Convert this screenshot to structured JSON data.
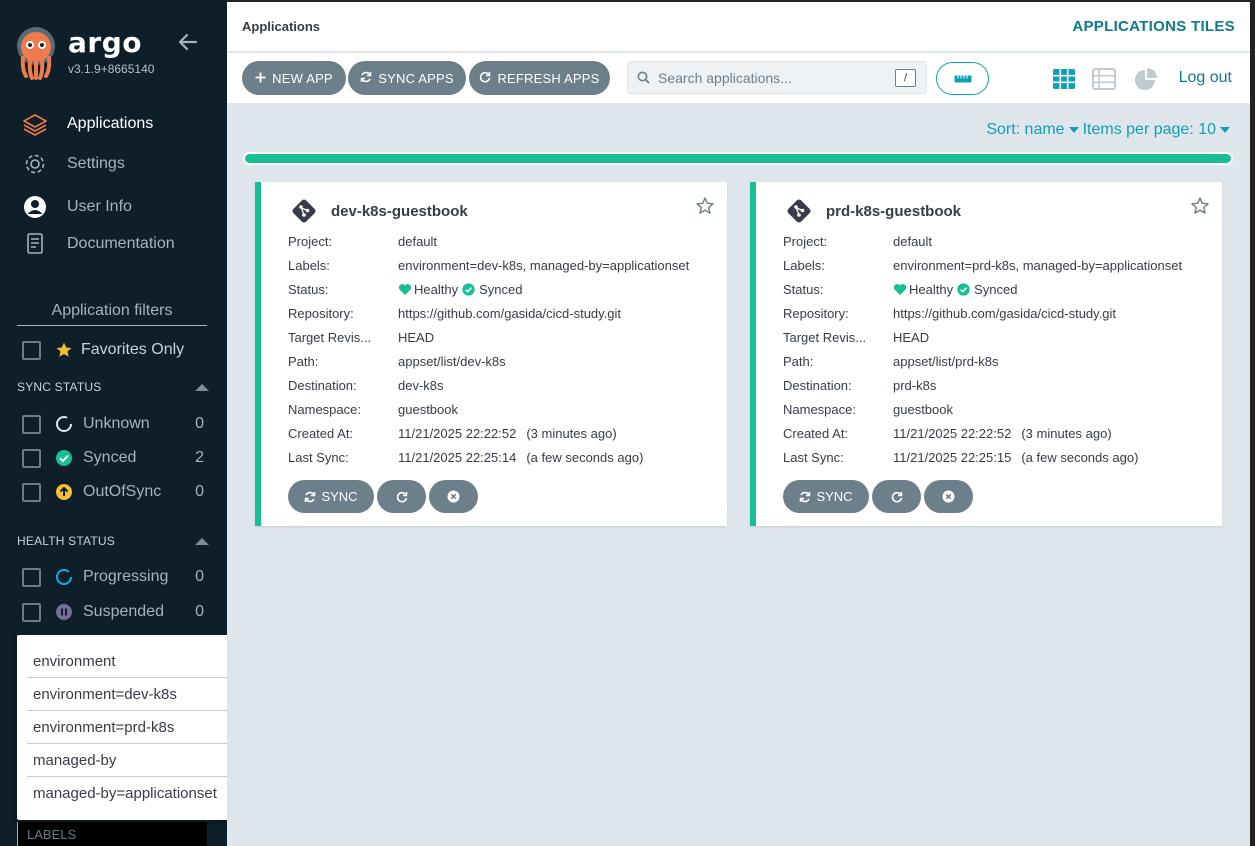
{
  "brand": {
    "title": "argo",
    "version": "v3.1.9+8665140"
  },
  "nav": [
    {
      "label": "Applications",
      "icon": "layers-icon"
    },
    {
      "label": "Settings",
      "icon": "gear-icon"
    },
    {
      "label": "User Info",
      "icon": "user-circle-icon"
    },
    {
      "label": "Documentation",
      "icon": "doc-icon"
    }
  ],
  "filters": {
    "title": "Application filters",
    "favorites_label": "Favorites Only",
    "sync_status": {
      "heading": "SYNC STATUS",
      "items": [
        {
          "label": "Unknown",
          "count": "0"
        },
        {
          "label": "Synced",
          "count": "2"
        },
        {
          "label": "OutOfSync",
          "count": "0"
        }
      ]
    },
    "health_status": {
      "heading": "HEALTH STATUS",
      "items": [
        {
          "label": "Progressing",
          "count": "0"
        },
        {
          "label": "Suspended",
          "count": "0"
        }
      ]
    },
    "label_options": [
      "environment",
      "environment=dev-k8s",
      "environment=prd-k8s",
      "managed-by",
      "managed-by=applicationset"
    ],
    "labels_placeholder": "LABELS"
  },
  "header": {
    "breadcrumb": "Applications",
    "page_tag": "APPLICATIONS TILES"
  },
  "toolbar": {
    "new_app": "NEW APP",
    "sync_apps": "SYNC APPS",
    "refresh_apps": "REFRESH APPS",
    "search_placeholder": "Search applications...",
    "search_shortcut": "/",
    "logout": "Log out"
  },
  "sort": {
    "label": "Sort: name",
    "items_per_page": "Items per page: 10"
  },
  "progress": {
    "percent": 100
  },
  "field_labels": {
    "project": "Project:",
    "labels": "Labels:",
    "status": "Status:",
    "repository": "Repository:",
    "target_revision": "Target Revis...",
    "path": "Path:",
    "destination": "Destination:",
    "namespace": "Namespace:",
    "created_at": "Created At:",
    "last_sync": "Last Sync:"
  },
  "apps": [
    {
      "name": "dev-k8s-guestbook",
      "project": "default",
      "labels": "environment=dev-k8s, managed-by=applicationset",
      "health": "Healthy",
      "sync": "Synced",
      "repository": "https://github.com/gasida/cicd-study.git",
      "target_revision": "HEAD",
      "path": "appset/list/dev-k8s",
      "destination": "dev-k8s",
      "namespace": "guestbook",
      "created_at": "11/21/2025 22:22:52",
      "created_rel": "(3 minutes ago)",
      "last_sync": "11/21/2025 22:25:14",
      "last_sync_rel": "(a few seconds ago)",
      "sync_button": "SYNC"
    },
    {
      "name": "prd-k8s-guestbook",
      "project": "default",
      "labels": "environment=prd-k8s, managed-by=applicationset",
      "health": "Healthy",
      "sync": "Synced",
      "repository": "https://github.com/gasida/cicd-study.git",
      "target_revision": "HEAD",
      "path": "appset/list/prd-k8s",
      "destination": "prd-k8s",
      "namespace": "guestbook",
      "created_at": "11/21/2025 22:22:52",
      "created_rel": "(3 minutes ago)",
      "last_sync": "11/21/2025 22:25:15",
      "last_sync_rel": "(a few seconds ago)",
      "sync_button": "SYNC"
    }
  ],
  "colors": {
    "sidebar_bg": "#0e1f29",
    "accent": "#0fa0b8",
    "healthy": "#18be94",
    "button": "#6d7f8b",
    "outofsync": "#f4c030",
    "suspended": "#766f94",
    "brand_orange": "#ef7b4d"
  }
}
